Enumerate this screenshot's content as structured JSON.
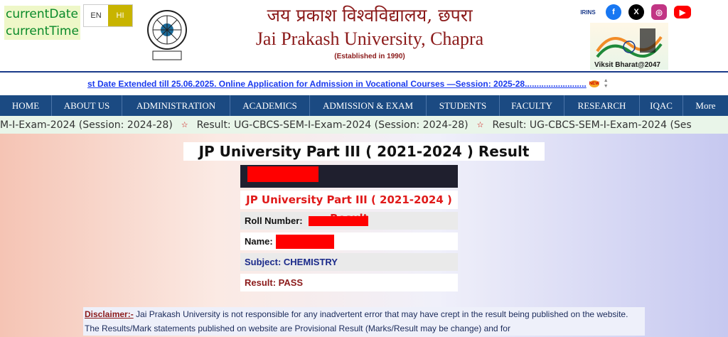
{
  "header": {
    "date_label": "currentDate",
    "time_label": "currentTime",
    "lang_en": "EN",
    "lang_hi": "HI",
    "title_hindi": "जय प्रकाश विश्वविद्यालय, छपरा",
    "title_english": "Jai Prakash University, Chapra",
    "established": "(Established in 1990)",
    "social": {
      "irins": "IRINS",
      "facebook": "f",
      "x": "X",
      "instagram": "◎",
      "youtube": "▶"
    },
    "viksit": "Viksit Bharat@2047"
  },
  "news": {
    "text": "st Date Extended till 25.06.2025. Online Application for Admission in Vocational Courses —Session: 2025-28..........................",
    "badge": "NEW"
  },
  "nav": {
    "items": [
      "HOME",
      "ABOUT US",
      "ADMINISTRATION",
      "ACADEMICS",
      "ADMISSION & EXAM",
      "STUDENTS",
      "FACULTY",
      "RESEARCH",
      "IQAC",
      "More"
    ]
  },
  "ticker": {
    "item1": "M-I-Exam-2024 (Session: 2024-28)",
    "item2": "Result: UG-CBCS-SEM-I-Exam-2024 (Session: 2024-28)",
    "item3": "Result: UG-CBCS-SEM-I-Exam-2024 (Ses",
    "star": "☆"
  },
  "main": {
    "title": "JP University Part III ( 2021-2024 ) Result",
    "card_title": "JP University Part III ( 2021-2024 ) Result",
    "roll_label": "Roll Number:",
    "name_label": "Name:",
    "subject": "Subject: CHEMISTRY",
    "result": "Result: PASS",
    "disclaimer_label": "Disclaimer:-",
    "disclaimer_text": " Jai Prakash University is not responsible for any inadvertent error that may have crept in the result being published on the website. The Results/Mark statements published on website are Provisional Result (Marks/Result may be change) and for"
  }
}
